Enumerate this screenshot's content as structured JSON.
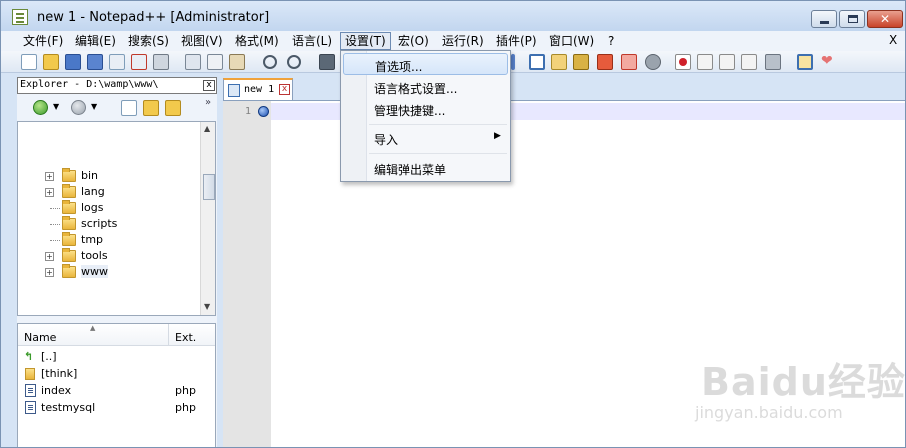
{
  "window": {
    "title": "new 1 - Notepad++ [Administrator]",
    "close_glyph": "✕"
  },
  "menubar": {
    "items": [
      "文件(F)",
      "编辑(E)",
      "搜索(S)",
      "视图(V)",
      "格式(M)",
      "语言(L)",
      "设置(T)",
      "宏(O)",
      "运行(R)",
      "插件(P)",
      "窗口(W)",
      "?"
    ],
    "active": "设置(T)",
    "close_x": "X"
  },
  "settings_menu": {
    "items": [
      {
        "label": "首选项...",
        "highlighted": true
      },
      {
        "label": "语言格式设置..."
      },
      {
        "label": "管理快捷键..."
      },
      {
        "label": "导入",
        "submenu_arrow": "▶"
      },
      {
        "label": "编辑弹出菜单"
      }
    ]
  },
  "explorer": {
    "title": "Explorer - D:\\wamp\\www\\",
    "close_glyph": "x",
    "more_glyph": "»",
    "tree": [
      {
        "name": "bin",
        "expandable": true
      },
      {
        "name": "lang",
        "expandable": true
      },
      {
        "name": "logs",
        "expandable": false
      },
      {
        "name": "scripts",
        "expandable": false
      },
      {
        "name": "tmp",
        "expandable": false
      },
      {
        "name": "tools",
        "expandable": true
      },
      {
        "name": "www",
        "expandable": true,
        "selected": true
      }
    ],
    "file_list": {
      "headers": {
        "name": "Name",
        "ext": "Ext."
      },
      "rows": [
        {
          "name": "[..]",
          "ext": "",
          "kind": "up"
        },
        {
          "name": "[think]",
          "ext": "",
          "kind": "folder"
        },
        {
          "name": "index",
          "ext": "php",
          "kind": "file"
        },
        {
          "name": "testmysql",
          "ext": "php",
          "kind": "file"
        }
      ]
    }
  },
  "editor": {
    "tab_label": "new 1",
    "tab_close": "x",
    "line_number": "1"
  },
  "watermark": {
    "logo": "Baidu经验",
    "url": "jingyan.baidu.com"
  },
  "colors": {
    "accent": "#f0a23a",
    "current_line": "#e8e8ff"
  }
}
